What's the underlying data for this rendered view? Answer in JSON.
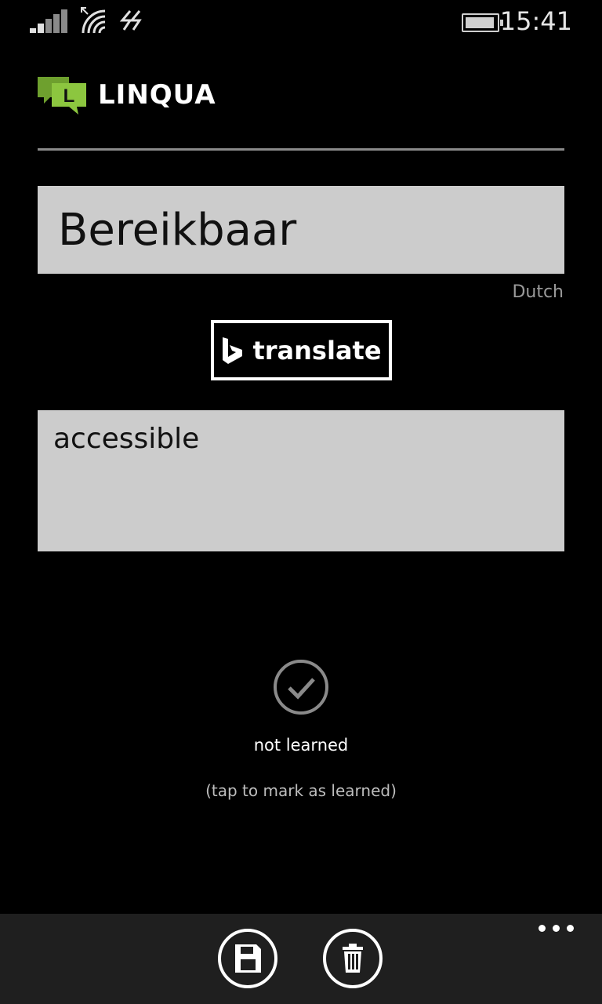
{
  "status_bar": {
    "time": "15:41",
    "icons": [
      "signal-icon",
      "wifi-icon",
      "data-icon",
      "battery-icon"
    ]
  },
  "header": {
    "app_title": "LINQUA",
    "logo_letter": "L",
    "logo_color": "#8cc63f"
  },
  "word": {
    "value": "Bereikbaar",
    "language": "Dutch"
  },
  "translate_button": {
    "label": "translate",
    "icon": "bing-icon"
  },
  "translation": {
    "value": "accessible"
  },
  "learned": {
    "state": "not learned",
    "hint": "(tap to mark as learned)"
  },
  "app_bar": {
    "buttons": [
      "save-icon",
      "delete-icon"
    ],
    "more_icon": "ellipsis-icon",
    "background": "#1f1f1f"
  }
}
